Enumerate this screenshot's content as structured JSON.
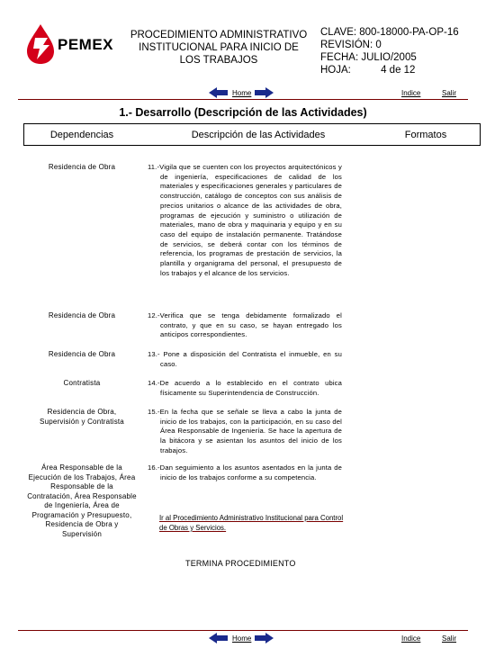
{
  "header": {
    "brand": "PEMEX",
    "title_lines": [
      "PROCEDIMIENTO ADMINISTRATIVO",
      "INSTITUCIONAL PARA INICIO DE",
      "LOS TRABAJOS"
    ],
    "clave": "CLAVE: 800-18000-PA-OP-16",
    "revision": "REVISIÓN: 0",
    "fecha": "FECHA: JULIO/2005",
    "hoja_label": "HOJA:",
    "hoja_value": "4 de 12"
  },
  "nav_top": {
    "home": "Home",
    "indice": "Indice",
    "salir": "Salir"
  },
  "nav_bottom": {
    "home": "Home",
    "indice": "Indice",
    "salir": "Salir"
  },
  "section_title": "1.- Desarrollo (Descripción de las Actividades)",
  "table_headers": {
    "dependencias": "Dependencias",
    "descripcion": "Descripción de las Actividades",
    "formatos": "Formatos"
  },
  "rows": [
    {
      "dependencia": "Residencia de Obra",
      "actividad": "11.-Vigila que se cuenten con los proyectos arquitectónicos y de ingeniería, especificaciones de calidad de los materiales y especificaciones generales y particulares de construcción, catálogo de conceptos con sus análisis de precios unitarios o alcance de las actividades de obra, programas de ejecución y suministro o utilización de materiales, mano de obra y maquinaria y equipo y en su caso del equipo de instalación permanente. Tratándose de servicios, se deberá contar con los términos de referencia, los programas de prestación de servicios, la plantilla y organigrama del personal, el presupuesto de los trabajos y el alcance de los servicios."
    },
    {
      "dependencia": "Residencia de Obra",
      "actividad": "12.-Verifica que se tenga debidamente formalizado el contrato, y que en su caso, se hayan entregado los anticipos correspondientes."
    },
    {
      "dependencia": "Residencia de Obra",
      "actividad": "13.- Pone a disposición del Contratista el inmueble, en su caso."
    },
    {
      "dependencia": "Contratista",
      "actividad": "14.-De acuerdo a lo establecido en el contrato ubica físicamente su Superintendencia de Construcción."
    },
    {
      "dependencia": "Residencia de Obra, Supervisión y Contratista",
      "actividad": "15.-En la fecha que se señale se lleva a cabo la junta de inicio de los trabajos, con la participación, en su caso del Área Responsable de Ingeniería. Se hace la apertura de la bitácora y se asientan los asuntos del inicio de los trabajos."
    },
    {
      "dependencia": "Área Responsable de la Ejecución de los Trabajos, Área Responsable de la Contratación, Área Responsable de Ingeniería, Área de Programación y Presupuesto, Residencia de Obra y Supervisión",
      "actividad": "16.-Dan seguimiento a los asuntos asentados en la junta de inicio de los trabajos conforme a su competencia."
    }
  ],
  "link_text": "Ir al Procedimiento Administrativo Institucional para Control de Obras y Servicios.",
  "termina": "TERMINA PROCEDIMIENTO"
}
